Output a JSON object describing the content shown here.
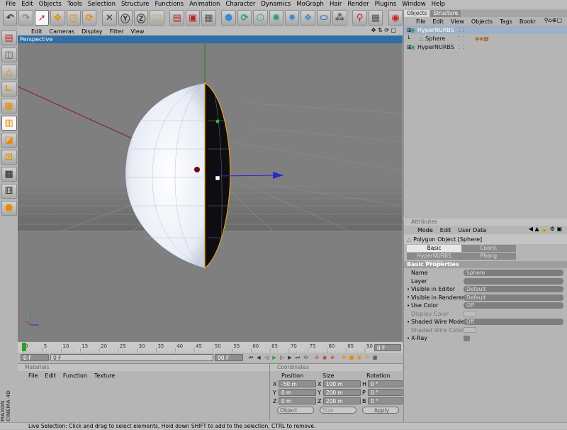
{
  "menubar": [
    "File",
    "Edit",
    "Objects",
    "Tools",
    "Selection",
    "Structure",
    "Functions",
    "Animation",
    "Character",
    "Dynamics",
    "MoGraph",
    "Hair",
    "Render",
    "Plugins",
    "Window",
    "Help"
  ],
  "viewport": {
    "menu": [
      "Edit",
      "Cameras",
      "Display",
      "Filter",
      "View"
    ],
    "nav": "✥ ⇅ ⟳ ▢",
    "label": "Perspective"
  },
  "timeline": {
    "ticks": [
      "0",
      "5",
      "10",
      "15",
      "20",
      "25",
      "30",
      "35",
      "40",
      "45",
      "50",
      "55",
      "60",
      "65",
      "70",
      "75",
      "80",
      "85",
      "90"
    ],
    "end_field": "0 F",
    "start_field": "0 F",
    "current_field": "0 F",
    "max_field": "90 F"
  },
  "materials": {
    "title": "Materials",
    "menu": [
      "File",
      "Edit",
      "Function",
      "Texture"
    ]
  },
  "coordinates": {
    "title": "Coordinates",
    "headers": [
      "Position",
      "Size",
      "Rotation"
    ],
    "rows": [
      {
        "axis": "X",
        "pos": "-50 m",
        "size_axis": "X",
        "size": "100 m",
        "rot_axis": "H",
        "rot": "0 °"
      },
      {
        "axis": "Y",
        "pos": "0 m",
        "size_axis": "Y",
        "size": "200 m",
        "rot_axis": "P",
        "rot": "0 °"
      },
      {
        "axis": "Z",
        "pos": "0 m",
        "size_axis": "Z",
        "size": "200 m",
        "rot_axis": "B",
        "rot": "0 °"
      }
    ],
    "mode_select": "Object",
    "size_select": "Size",
    "apply": "Apply"
  },
  "status": "Live Selection: Click and drag to select elements, Hold down SHIFT to add to the selection, CTRL to remove.",
  "brand": "MAXON CINEMA 4D",
  "objects_panel": {
    "tabs": [
      "Objects",
      "Structure"
    ],
    "menu": [
      "File",
      "Edit",
      "View",
      "Objects",
      "Tags",
      "Bookr"
    ],
    "items": [
      {
        "name": "HyperNURBS",
        "level": 0,
        "selected": true
      },
      {
        "name": "Sphere",
        "level": 1,
        "selected": false
      },
      {
        "name": "HyperNURBS",
        "level": 0,
        "selected": false
      }
    ]
  },
  "attributes": {
    "title": "Attributes",
    "menu": [
      "Mode",
      "Edit",
      "User Data"
    ],
    "object_title": "Polygon Object [Sphere]",
    "tabs": [
      "Basic",
      "Coord.",
      "HyperNURBS Weight",
      "Phong"
    ],
    "section": "Basic Properties",
    "rows": [
      {
        "label": "Name",
        "value": "Sphere",
        "dim": false
      },
      {
        "label": "Layer",
        "value": "",
        "dim": false
      },
      {
        "label": "Visible in Editor",
        "value": "Default",
        "dim": false
      },
      {
        "label": "Visible in Renderer",
        "value": "Default",
        "dim": false
      },
      {
        "label": "Use Color",
        "value": "Off",
        "dim": false
      },
      {
        "label": "Display Color",
        "value": "",
        "dim": true
      },
      {
        "label": "Shaded Wire Mode",
        "value": "Off",
        "dim": false
      },
      {
        "label": "Shaded Wire Color",
        "value": "",
        "dim": true
      },
      {
        "label": "X-Ray",
        "value": "",
        "dim": false
      }
    ]
  }
}
